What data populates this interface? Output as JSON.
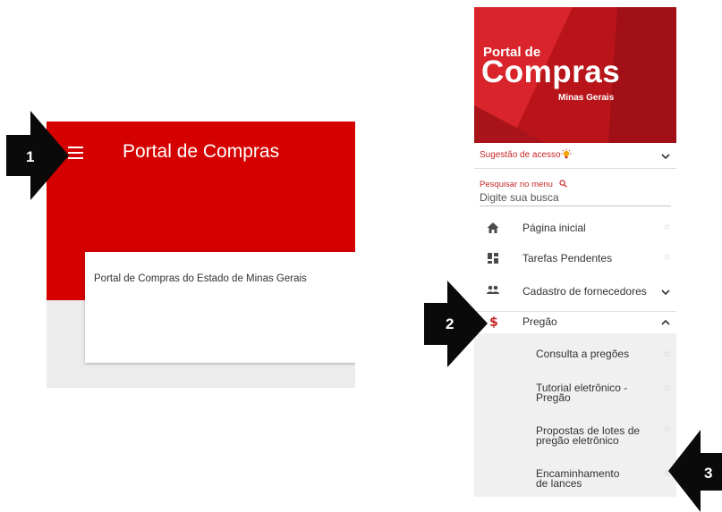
{
  "left_screen": {
    "header_title": "Portal de Compras",
    "card_text": "Portal de Compras do Estado de Minas Gerais",
    "header_color": "#d50000"
  },
  "right_screen": {
    "brand": {
      "line1": "Portal de",
      "line2": "Compras",
      "line3": "Minas Gerais",
      "color": "#c8161b"
    },
    "suggestion_label": "Sugestão de acesso",
    "search": {
      "label": "Pesquisar no menu",
      "placeholder": "Digite sua busca"
    },
    "menu_items": [
      {
        "label": "Página inicial",
        "icon": "home-icon",
        "favorite": false
      },
      {
        "label": "Tarefas Pendentes",
        "icon": "dashboard-icon",
        "favorite": false
      },
      {
        "label": "Cadastro de fornecedores",
        "icon": "people-icon",
        "expandable": true
      },
      {
        "label": "Pregão",
        "icon": "dollar-icon",
        "expanded": true
      }
    ],
    "submenu_items": [
      {
        "label": "Consulta a pregões",
        "favorite": false
      },
      {
        "label": "Tutorial eletrônico - Pregão",
        "favorite": false
      },
      {
        "label": "Propostas de lotes de pregão eletrônico",
        "favorite": false
      },
      {
        "label": "Encaminhamento de lances",
        "favorite": false
      }
    ],
    "accent_color": "#c62828"
  },
  "callouts": [
    {
      "number": "1"
    },
    {
      "number": "2"
    },
    {
      "number": "3"
    }
  ]
}
